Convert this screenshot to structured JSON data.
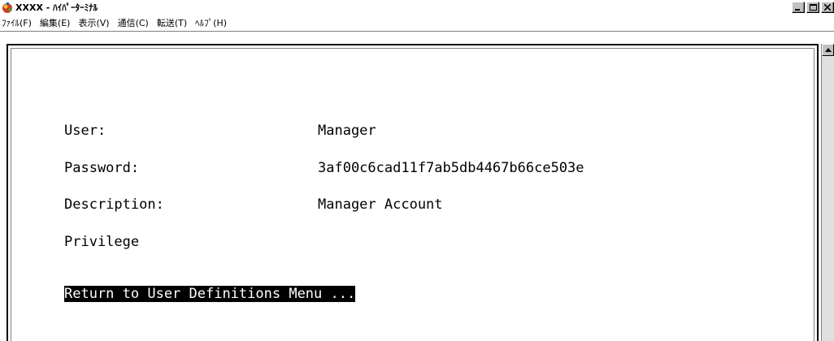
{
  "window": {
    "title": "XXXX - ﾊｲﾊﾟｰﾀｰﾐﾅﾙ"
  },
  "menu": [
    {
      "label": "ﾌｧｲﾙ(F)"
    },
    {
      "label": "編集(E)"
    },
    {
      "label": "表示(V)"
    },
    {
      "label": "通信(C)"
    },
    {
      "label": "転送(T)"
    },
    {
      "label": "ﾍﾙﾌﾟ(H)"
    }
  ],
  "terminal": {
    "fields": [
      {
        "label": "User:",
        "value": "Manager"
      },
      {
        "label": "Password:",
        "value": "3af00c6cad11f7ab5db4467b66ce503e"
      },
      {
        "label": "Description:",
        "value": "Manager Account"
      },
      {
        "label": "Privilege",
        "value": ""
      }
    ],
    "return_option": "Return to User Definitions Menu ..."
  },
  "colors": {
    "background": "#ffffff",
    "highlight_bg": "#000000",
    "highlight_fg": "#ffffff",
    "chrome": "#c0c0c0"
  },
  "icons": {
    "app": "hyperterminal-icon",
    "minimize": "minimize-icon",
    "maximize": "maximize-icon",
    "close": "close-icon",
    "scroll_up": "scroll-up-arrow-icon"
  }
}
